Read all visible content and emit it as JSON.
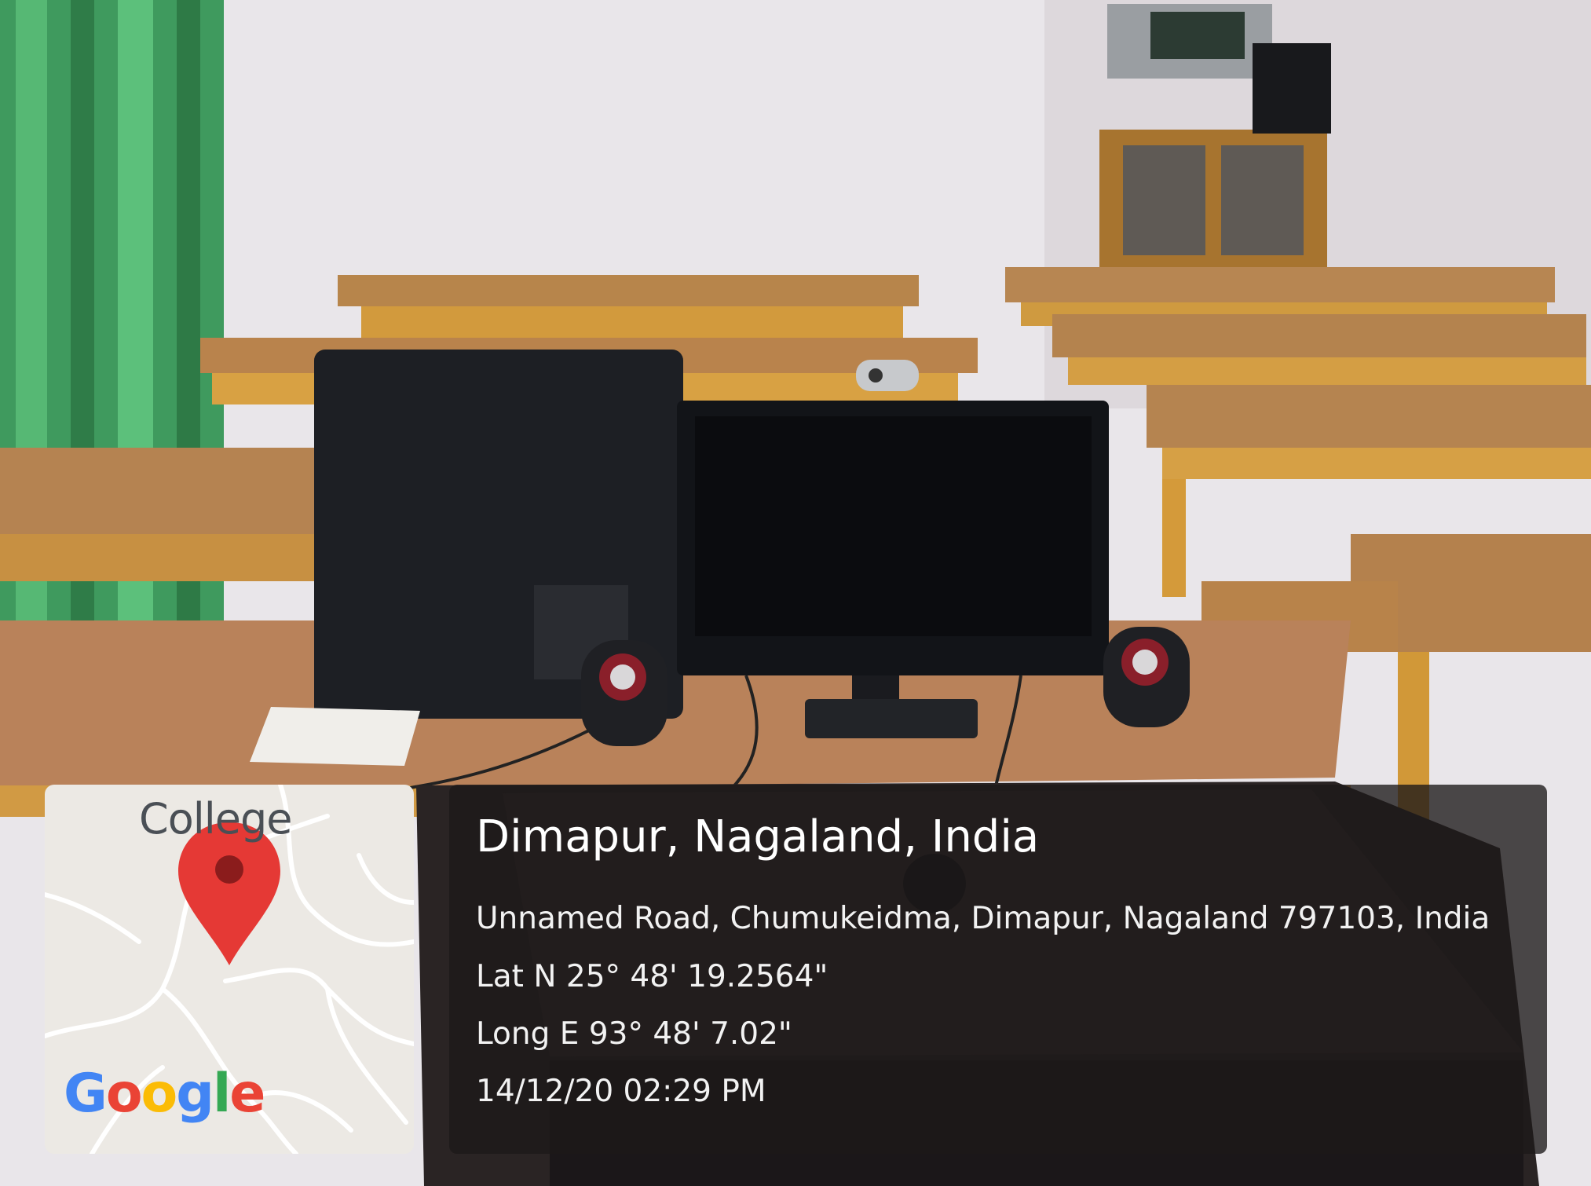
{
  "map": {
    "place_label": "College",
    "logo": {
      "letters": [
        "G",
        "o",
        "o",
        "g",
        "l",
        "e"
      ]
    },
    "pin_color": "#e53935"
  },
  "location": {
    "title": "Dimapur, Nagaland, India",
    "address": "Unnamed Road, Chumukeidma, Dimapur, Nagaland 797103, India",
    "latitude": "Lat N 25° 48' 19.2564\"",
    "longitude": "Long E 93° 48' 7.02\"",
    "timestamp": "14/12/20 02:29 PM"
  }
}
